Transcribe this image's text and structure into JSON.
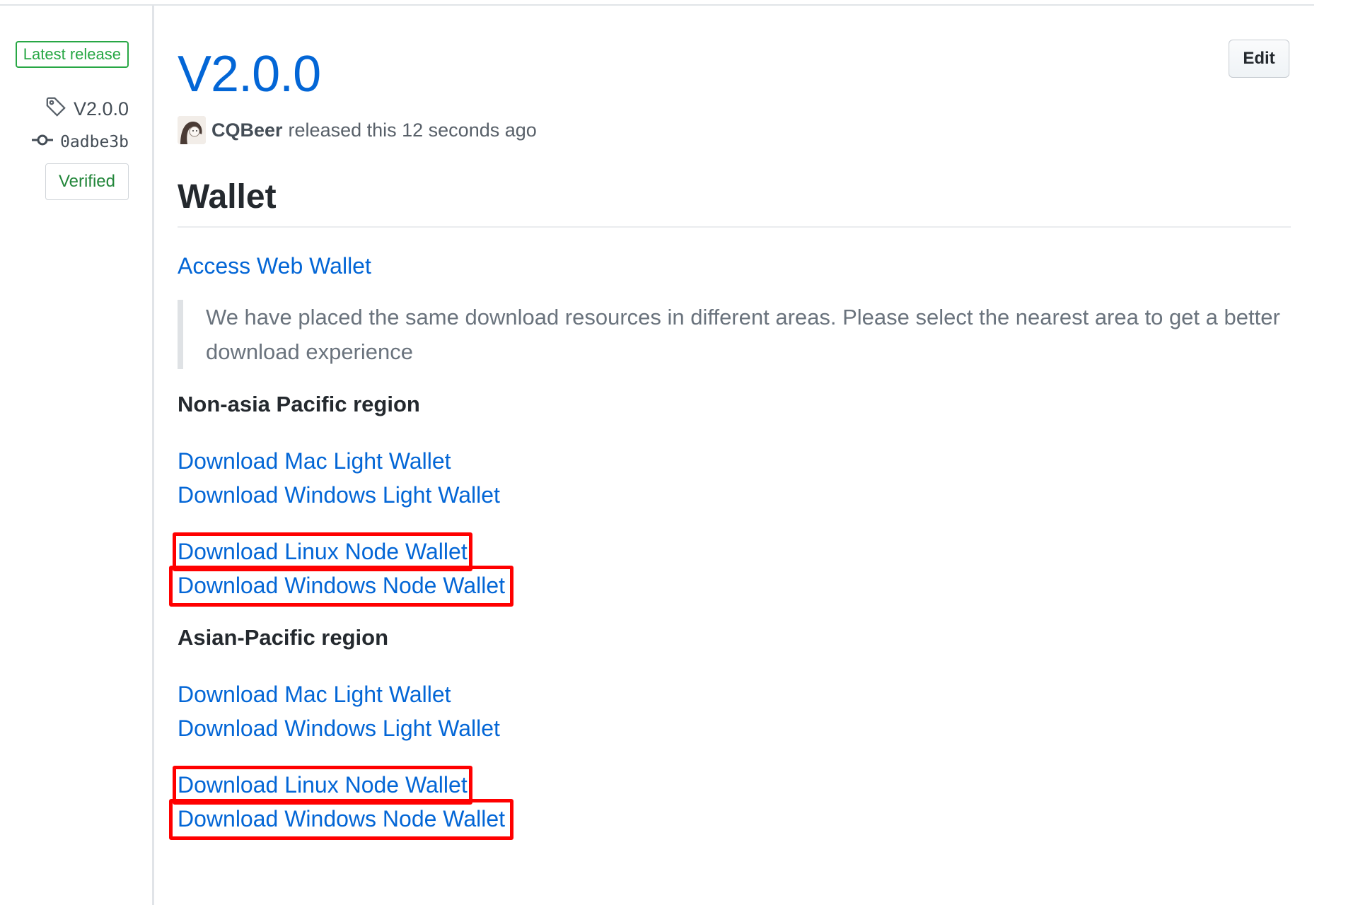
{
  "sidebar": {
    "latest_label": "Latest release",
    "tag_name": "V2.0.0",
    "commit_sha": "0adbe3b",
    "verified_label": "Verified"
  },
  "release": {
    "title": "V2.0.0",
    "edit_label": "Edit",
    "author": "CQBeer",
    "released_text": "released this 12 seconds ago"
  },
  "body": {
    "heading": "Wallet",
    "access_link": "Access Web Wallet",
    "note": "We have placed the same download resources in different areas. Please select the nearest area to get a better download experience",
    "regions": [
      {
        "title": "Non-asia Pacific region",
        "light_links": [
          "Download Mac Light Wallet",
          "Download Windows Light Wallet"
        ],
        "node_links": [
          "Download Linux Node Wallet",
          "Download Windows Node Wallet"
        ]
      },
      {
        "title": "Asian-Pacific region",
        "light_links": [
          "Download Mac Light Wallet",
          "Download Windows Light Wallet"
        ],
        "node_links": [
          "Download Linux Node Wallet",
          "Download Windows Node Wallet"
        ]
      }
    ]
  },
  "colors": {
    "link": "#0366d6",
    "latest_green": "#28a745",
    "highlight_red": "#ff0000"
  },
  "icons": [
    "tag-icon",
    "git-commit-icon",
    "avatar"
  ]
}
